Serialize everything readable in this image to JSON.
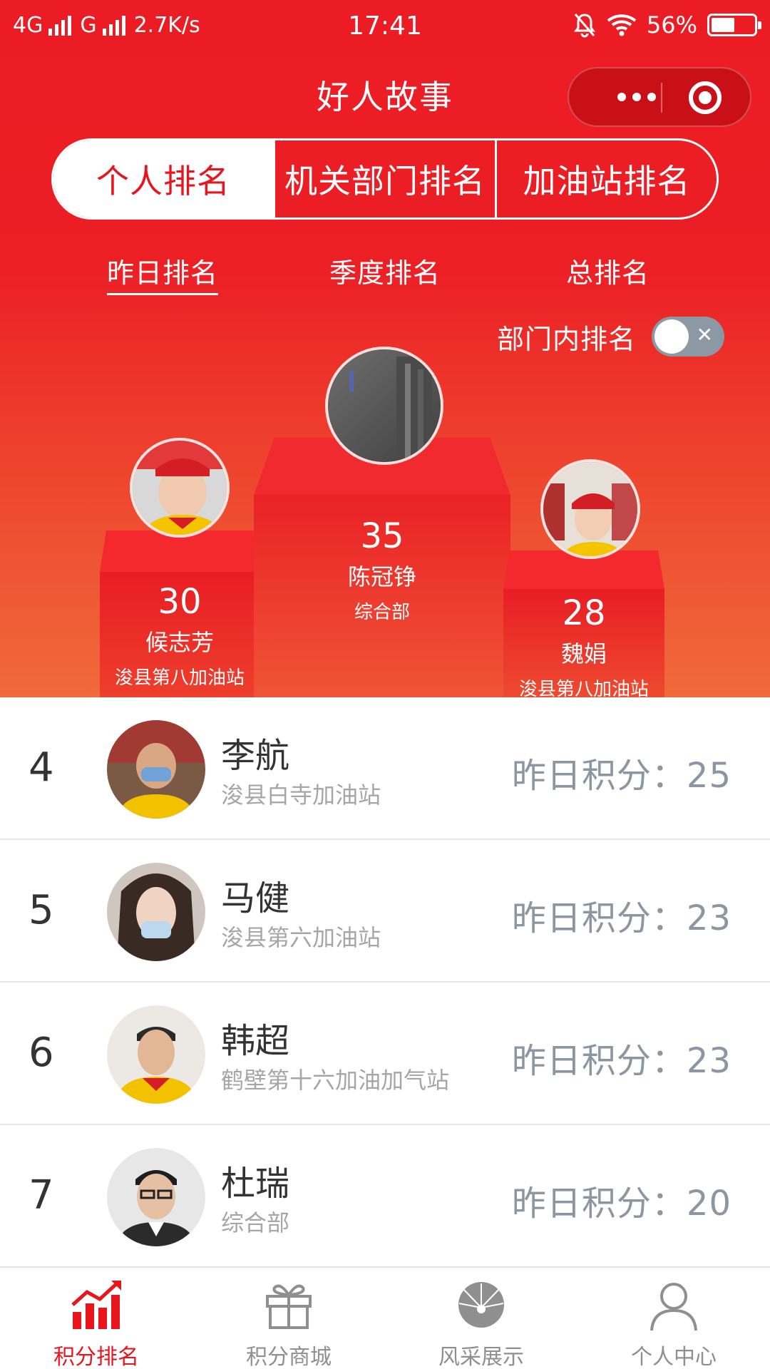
{
  "status_bar": {
    "network1": "4G",
    "network2": "G",
    "speed": "2.7K/s",
    "time": "17:41",
    "battery": "56%",
    "battery_level": 0.56
  },
  "nav": {
    "title": "好人故事"
  },
  "segments": [
    {
      "label": "个人排名",
      "active": true
    },
    {
      "label": "机关部门排名",
      "active": false
    },
    {
      "label": "加油站排名",
      "active": false
    }
  ],
  "subtabs": [
    {
      "label": "昨日排名",
      "active": true
    },
    {
      "label": "季度排名",
      "active": false
    },
    {
      "label": "总排名",
      "active": false
    }
  ],
  "toggle": {
    "label": "部门内排名",
    "on": false,
    "icon": "close-icon"
  },
  "podium": {
    "first": {
      "score": "35",
      "name": "陈冠铮",
      "dept": "综合部"
    },
    "second": {
      "score": "30",
      "name": "候志芳",
      "dept": "浚县第八加油站"
    },
    "third": {
      "score": "28",
      "name": "魏娟",
      "dept": "浚县第八加油站"
    }
  },
  "list": [
    {
      "rank": "4",
      "name": "李航",
      "dept": "浚县白寺加油站",
      "score_label": "昨日积分：",
      "score": "25"
    },
    {
      "rank": "5",
      "name": "马健",
      "dept": "浚县第六加油站",
      "score_label": "昨日积分：",
      "score": "23"
    },
    {
      "rank": "6",
      "name": "韩超",
      "dept": "鹤壁第十六加油加气站",
      "score_label": "昨日积分：",
      "score": "23"
    },
    {
      "rank": "7",
      "name": "杜瑞",
      "dept": "综合部",
      "score_label": "昨日积分：",
      "score": "20"
    }
  ],
  "tabbar": [
    {
      "label": "积分排名",
      "icon": "bar-chart-icon",
      "active": true
    },
    {
      "label": "积分商城",
      "icon": "gift-icon",
      "active": false
    },
    {
      "label": "风采展示",
      "icon": "emblem-icon",
      "active": false
    },
    {
      "label": "个人中心",
      "icon": "user-icon",
      "active": false
    }
  ],
  "colors": {
    "brand_red": "#e8151d",
    "toggle_off": "#8c98a3",
    "score_gray": "#8a96a2"
  }
}
